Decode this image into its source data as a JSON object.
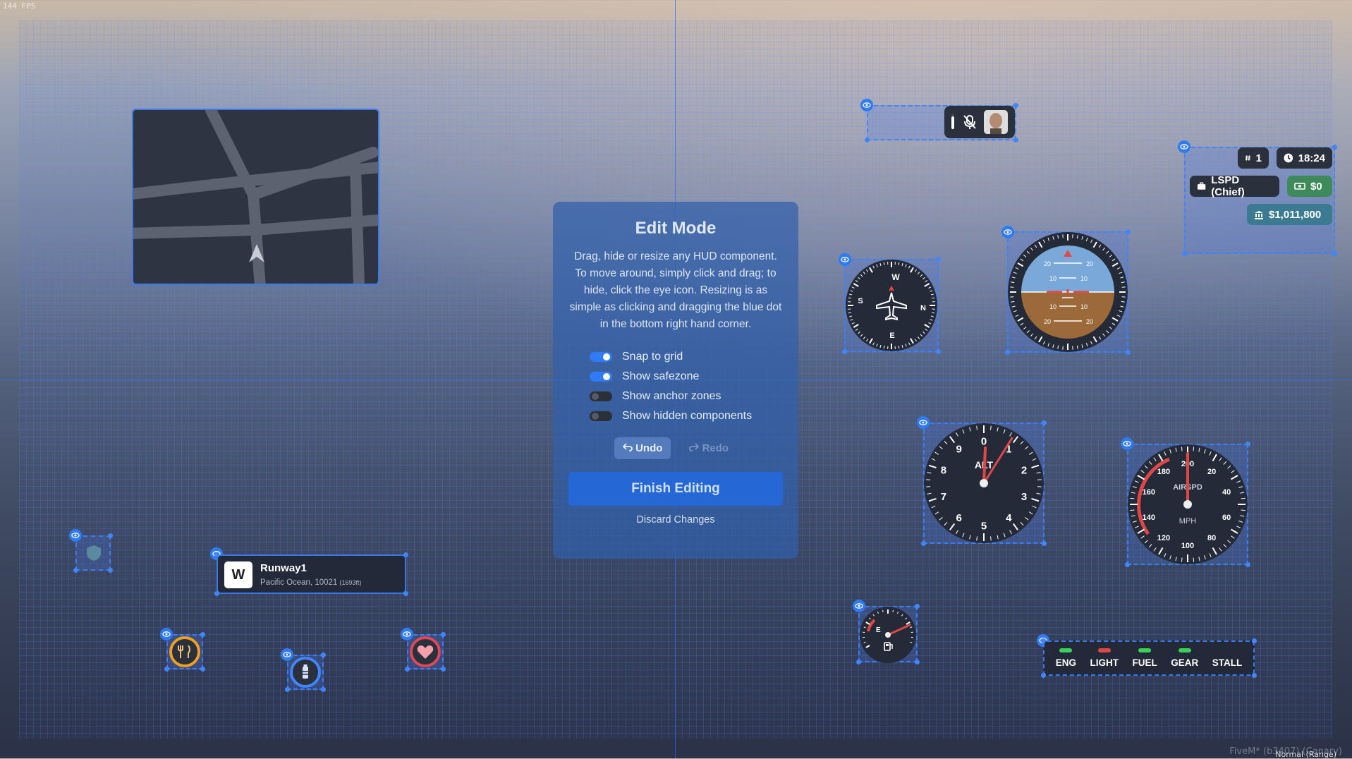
{
  "overlay": {
    "fps": "144 FPS",
    "watermark": "FiveM* (b3407) (Canary)",
    "watermark_sub": "Normal (Range)"
  },
  "edit_panel": {
    "title": "Edit Mode",
    "description": "Drag, hide or resize any HUD component. To move around, simply click and drag; to hide, click the eye icon. Resizing is as simple as clicking and dragging the blue dot in the bottom right hand corner.",
    "toggles": [
      {
        "label": "Snap to grid",
        "on": true
      },
      {
        "label": "Show safezone",
        "on": true
      },
      {
        "label": "Show anchor zones",
        "on": false
      },
      {
        "label": "Show hidden components",
        "on": false
      }
    ],
    "undo_label": "Undo",
    "redo_label": "Redo",
    "finish_label": "Finish Editing",
    "discard_label": "Discard Changes"
  },
  "info": {
    "server_id": "1",
    "time": "18:24",
    "job": "LSPD (Chief)",
    "cash": "$0",
    "bank": "$1,011,800"
  },
  "location": {
    "direction": "W",
    "street": "Runway1",
    "zone": "Pacific Ocean, 10021",
    "altitude": "(1693ft)"
  },
  "warnings": [
    {
      "label": "ENG",
      "color": "#3ad05a"
    },
    {
      "label": "LIGHT",
      "color": "#e04848"
    },
    {
      "label": "FUEL",
      "color": "#3ad05a"
    },
    {
      "label": "GEAR",
      "color": "#3ad05a"
    },
    {
      "label": "STALL",
      "color": "#232938"
    }
  ],
  "gauges": {
    "altimeter_label": "ALT",
    "altimeter_numbers": [
      "0",
      "1",
      "2",
      "3",
      "4",
      "5",
      "6",
      "7",
      "8",
      "9"
    ],
    "airspeed_label": "AIRSPD",
    "airspeed_unit": "MPH",
    "airspeed_numbers": [
      "20",
      "40",
      "60",
      "80",
      "100",
      "120",
      "140",
      "160",
      "180",
      "200"
    ],
    "horizon_marks": [
      "20",
      "10",
      "10",
      "20"
    ],
    "compass_letters": [
      "W",
      "N",
      "S",
      "E"
    ],
    "fuel_labels": [
      "E",
      "F"
    ]
  },
  "status": {
    "armor_icon": "shield-icon",
    "hunger_icon": "fork-knife-icon",
    "thirst_icon": "bottle-icon",
    "health_icon": "heart-icon"
  },
  "colors": {
    "accent": "#2f7af5",
    "panel": "#305faa",
    "hunger": "#f0a020",
    "thirst": "#3f86ff",
    "health": "#e04858"
  }
}
